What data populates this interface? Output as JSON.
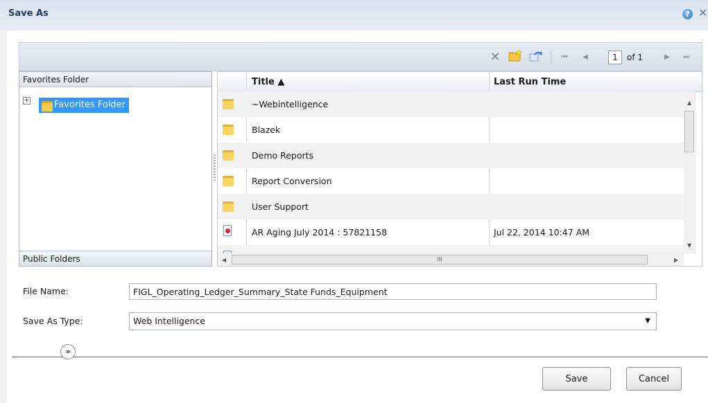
{
  "dialog": {
    "title": "Save As",
    "help_glyph": "?",
    "close_glyph": "✕"
  },
  "toolbar": {
    "delete_glyph": "✕",
    "new_folder_glyph": "📁",
    "refresh_glyph": "⟳",
    "first_glyph": "⏮",
    "prev_glyph": "◀",
    "current_page": "1",
    "page_of": "of 1",
    "next_glyph": "▶",
    "last_glyph": "⏭"
  },
  "left_pane": {
    "favorites_header": "Favorites Folder",
    "tree_root": "Favorites Folder",
    "public_header": "Public Folders"
  },
  "grid": {
    "columns": {
      "title": "Title ▲",
      "last_run": "Last Run Time"
    },
    "rows": [
      {
        "type": "folder",
        "title": "~Webintelligence",
        "last_run": ""
      },
      {
        "type": "folder",
        "title": "Blazek",
        "last_run": ""
      },
      {
        "type": "folder",
        "title": "Demo Reports",
        "last_run": ""
      },
      {
        "type": "folder",
        "title": "Report Conversion",
        "last_run": ""
      },
      {
        "type": "folder",
        "title": "User Support",
        "last_run": ""
      },
      {
        "type": "document",
        "title": "AR Aging July 2014 : 57821158",
        "last_run": "Jul 22, 2014 10:47 AM"
      }
    ],
    "hscroll_grip": "III"
  },
  "form": {
    "file_name_label": "File Name:",
    "file_name_value": "FIGL_Operating_Ledger_Summary_State Funds_Equipment",
    "type_label": "Save As Type:",
    "type_value": "Web Intelligence"
  },
  "footer": {
    "expand_glyph": "»",
    "save_label": "Save",
    "cancel_label": "Cancel"
  }
}
